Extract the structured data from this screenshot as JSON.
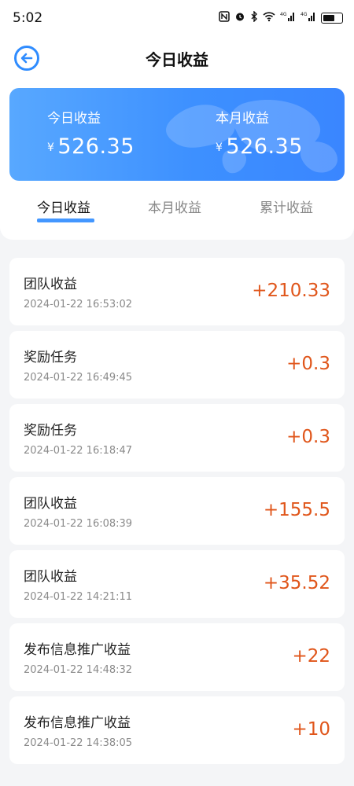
{
  "status": {
    "time": "5:02",
    "icons": [
      "nfc-icon",
      "alarm-icon",
      "bluetooth-icon",
      "wifi-icon",
      "signal-4g-icon",
      "signal-4g-icon",
      "battery-icon"
    ]
  },
  "header": {
    "title": "今日收益"
  },
  "summary": {
    "today_label": "今日收益",
    "today_currency": "¥",
    "today_value": "526.35",
    "month_label": "本月收益",
    "month_currency": "¥",
    "month_value": "526.35"
  },
  "tabs": [
    {
      "label": "今日收益",
      "active": true
    },
    {
      "label": "本月收益",
      "active": false
    },
    {
      "label": "累计收益",
      "active": false
    }
  ],
  "records": [
    {
      "title": "团队收益",
      "time": "2024-01-22 16:53:02",
      "amount": "+210.33"
    },
    {
      "title": "奖励任务",
      "time": "2024-01-22 16:49:45",
      "amount": "+0.3"
    },
    {
      "title": "奖励任务",
      "time": "2024-01-22 16:18:47",
      "amount": "+0.3"
    },
    {
      "title": "团队收益",
      "time": "2024-01-22 16:08:39",
      "amount": "+155.5"
    },
    {
      "title": "团队收益",
      "time": "2024-01-22 14:21:11",
      "amount": "+35.52"
    },
    {
      "title": "发布信息推广收益",
      "time": "2024-01-22 14:48:32",
      "amount": "+22"
    },
    {
      "title": "发布信息推广收益",
      "time": "2024-01-22 14:38:05",
      "amount": "+10"
    }
  ],
  "colors": {
    "accent": "#2f8cff",
    "amount": "#e0561b",
    "background": "#f4f5f7"
  }
}
